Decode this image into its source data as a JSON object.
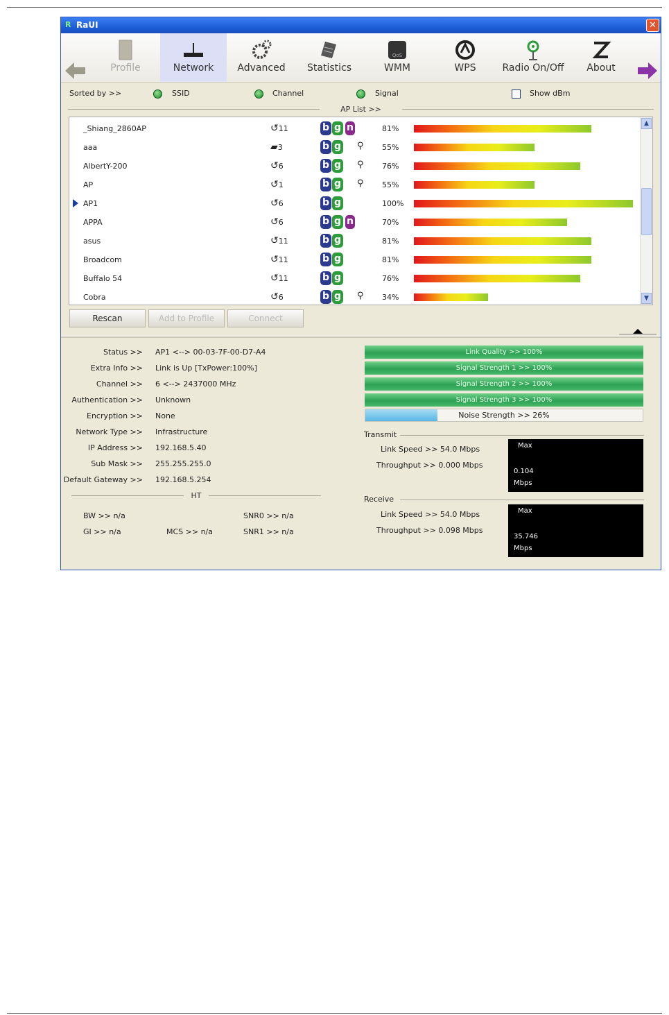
{
  "window": {
    "title": "RaUI",
    "close_icon": "close-icon"
  },
  "toolbar": {
    "items": [
      {
        "label": "Profile",
        "icon": "profile-icon",
        "active": false,
        "disabled": true
      },
      {
        "label": "Network",
        "icon": "network-icon",
        "active": true
      },
      {
        "label": "Advanced",
        "icon": "advanced-icon"
      },
      {
        "label": "Statistics",
        "icon": "statistics-icon"
      },
      {
        "label": "WMM",
        "icon": "wmm-icon"
      },
      {
        "label": "WPS",
        "icon": "wps-icon"
      },
      {
        "label": "Radio On/Off",
        "icon": "radio-icon"
      },
      {
        "label": "About",
        "icon": "about-icon"
      }
    ]
  },
  "sort": {
    "label": "Sorted by >>",
    "ssid": "SSID",
    "channel": "Channel",
    "signal": "Signal",
    "show_dbm": "Show dBm"
  },
  "ap_list": {
    "header": "AP List >>",
    "rows": [
      {
        "ssid": "_Shiang_2860AP",
        "channel": "11",
        "b": "b",
        "g": "g",
        "n": "n",
        "key": false,
        "signal": "81%",
        "level": 0.81
      },
      {
        "ssid": "aaa",
        "channel": "3",
        "b": "b",
        "g": "g",
        "n": null,
        "key": true,
        "signal": "55%",
        "level": 0.55
      },
      {
        "ssid": "AlbertY-200",
        "channel": "6",
        "b": "b",
        "g": "g",
        "n": null,
        "key": true,
        "signal": "76%",
        "level": 0.76
      },
      {
        "ssid": "AP",
        "channel": "1",
        "b": "b",
        "g": "g",
        "n": null,
        "key": true,
        "signal": "55%",
        "level": 0.55
      },
      {
        "ssid": "AP1",
        "channel": "6",
        "b": "b",
        "g": "g",
        "n": null,
        "key": false,
        "signal": "100%",
        "level": 1.0,
        "selected": true
      },
      {
        "ssid": "APPA",
        "channel": "6",
        "b": "b",
        "g": "g",
        "n": "n",
        "key": false,
        "signal": "70%",
        "level": 0.7
      },
      {
        "ssid": "asus",
        "channel": "11",
        "b": "b",
        "g": "g",
        "n": null,
        "key": false,
        "signal": "81%",
        "level": 0.81
      },
      {
        "ssid": "Broadcom",
        "channel": "11",
        "b": "b",
        "g": "g",
        "n": null,
        "key": false,
        "signal": "81%",
        "level": 0.81
      },
      {
        "ssid": "Buffalo 54",
        "channel": "11",
        "b": "b",
        "g": "g",
        "n": null,
        "key": false,
        "signal": "76%",
        "level": 0.76
      },
      {
        "ssid": "Cobra",
        "channel": "6",
        "b": "b",
        "g": "g",
        "n": null,
        "key": true,
        "signal": "34%",
        "level": 0.34
      }
    ]
  },
  "buttons": {
    "rescan": "Rescan",
    "add_to_profile": "Add to Profile",
    "connect": "Connect"
  },
  "status": {
    "rows": [
      {
        "label": "Status >>",
        "value": "AP1 <--> 00-03-7F-00-D7-A4"
      },
      {
        "label": "Extra Info >>",
        "value": "Link is Up [TxPower:100%]"
      },
      {
        "label": "Channel >>",
        "value": "6 <--> 2437000 MHz"
      },
      {
        "label": "Authentication >>",
        "value": "Unknown"
      },
      {
        "label": "Encryption >>",
        "value": "None"
      },
      {
        "label": "Network Type >>",
        "value": "Infrastructure"
      },
      {
        "label": "IP Address >>",
        "value": "192.168.5.40"
      },
      {
        "label": "Sub Mask >>",
        "value": "255.255.255.0"
      },
      {
        "label": "Default Gateway >>",
        "value": "192.168.5.254"
      }
    ]
  },
  "ht": {
    "header": "HT",
    "bw": "BW >> n/a",
    "gi": "GI >> n/a",
    "mcs": "MCS >> n/a",
    "snr0": "SNR0 >> n/a",
    "snr1": "SNR1 >> n/a"
  },
  "quality": {
    "link_quality": "Link Quality >> 100%",
    "signal1": "Signal Strength 1 >> 100%",
    "signal2": "Signal Strength 2 >> 100%",
    "signal3": "Signal Strength 3 >> 100%",
    "noise": "Noise Strength >> 26%",
    "noise_level": 0.26
  },
  "transmit": {
    "header": "Transmit",
    "link_speed": "Link Speed >> 54.0 Mbps",
    "throughput": "Throughput >> 0.000 Mbps",
    "graph_max": "Max",
    "graph_value": "0.104",
    "graph_unit": "Mbps"
  },
  "receive": {
    "header": "Receive",
    "link_speed": "Link Speed >> 54.0 Mbps",
    "throughput": "Throughput >> 0.098 Mbps",
    "graph_max": "Max",
    "graph_value": "35.746",
    "graph_unit": "Mbps"
  }
}
